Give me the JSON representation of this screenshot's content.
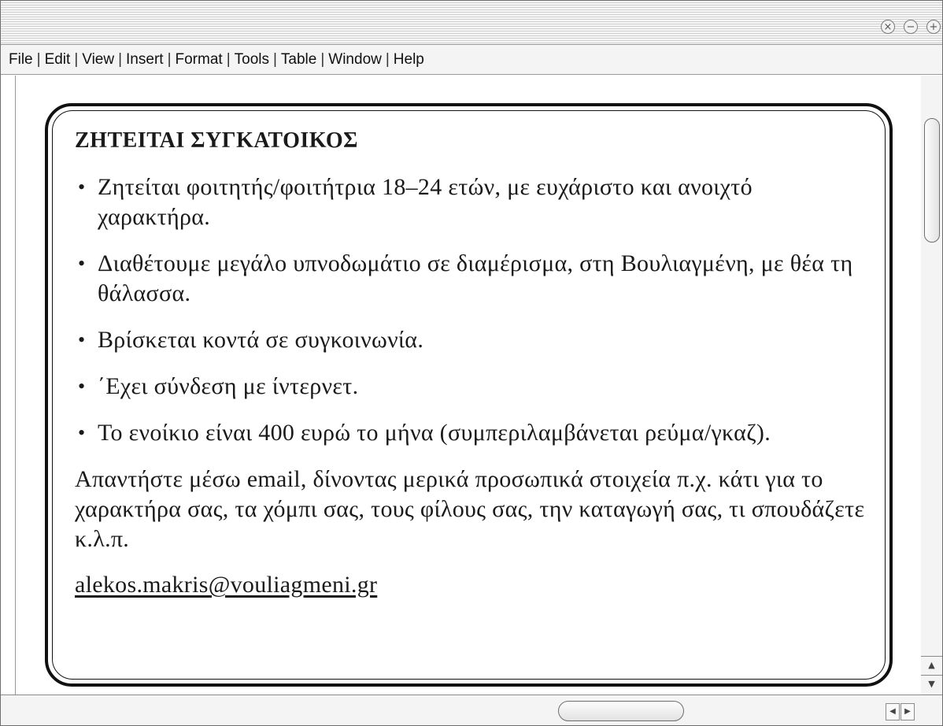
{
  "window": {
    "controls": [
      {
        "name": "close-icon",
        "glyph": "×"
      },
      {
        "name": "minimize-icon",
        "glyph": "−"
      },
      {
        "name": "maximize-icon",
        "glyph": "+"
      }
    ]
  },
  "menubar": {
    "items": [
      "File",
      "Edit",
      "View",
      "Insert",
      "Format",
      "Tools",
      "Table",
      "Window",
      "Help"
    ],
    "separator": "|"
  },
  "ad": {
    "title": "ΖΗΤΕΙΤΑΙ ΣΥΓΚΑΤΟΙΚΟΣ",
    "bullet_glyph": "•",
    "bullets": [
      "Ζητείται φοιτητής/φοιτήτρια 18–24 ετών, με ευχάριστο και ανοιχτό χαρακτήρα.",
      "Διαθέτουμε μεγάλο υπνοδωμάτιο σε διαμέρισμα, στη Βουλιαγμένη, με θέα τη θάλασσα.",
      "Βρίσκεται κοντά σε συγκοινωνία.",
      "΄Εχει σύνδεση με ίντερνετ.",
      "Το ενοίκιο είναι 400 ευρώ το μήνα (συμπεριλαμβάνεται ρεύμα/γκαζ)."
    ],
    "reply": "Απαντήστε μέσω email, δίνοντας μερικά προσωπικά στοιχεία π.χ. κάτι για το χαρακτήρα σας, τα χόμπι σας, τους φίλους σας, την καταγωγή σας, τι σπουδάζετε κ.λ.π.",
    "email": "alekos.makris@vouliagmeni.gr"
  },
  "scrollbars": {
    "up_arrow": "▲",
    "down_arrow": "▼",
    "left_arrow": "◀",
    "right_arrow": "▶"
  }
}
